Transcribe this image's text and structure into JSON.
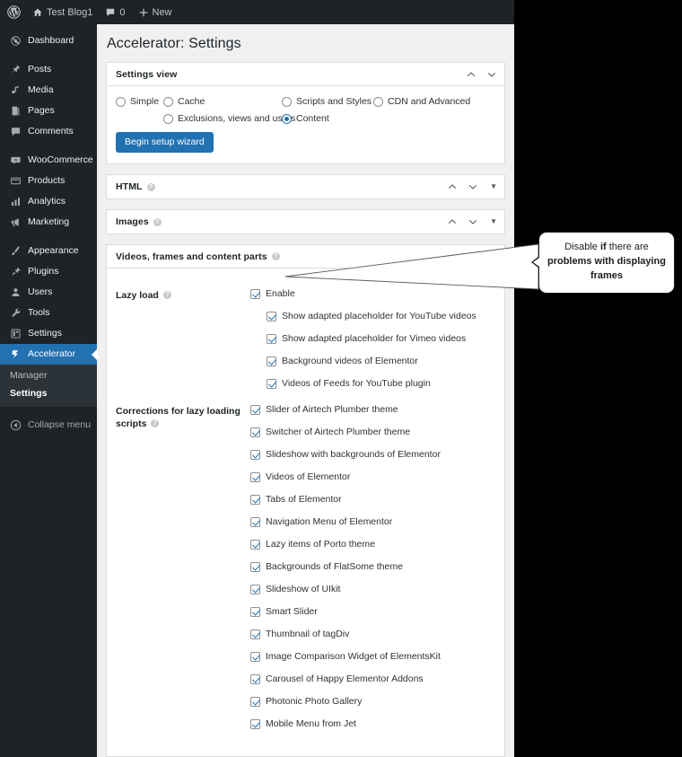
{
  "adminbar": {
    "items": [
      {
        "icon": "wordpress-logo-icon",
        "label": ""
      },
      {
        "icon": "home-icon",
        "label": "Test Blog1"
      },
      {
        "icon": "comment-icon",
        "label": "0"
      },
      {
        "icon": "plus-icon",
        "label": "New"
      }
    ]
  },
  "sidebar": {
    "items": [
      {
        "label": "Dashboard",
        "icon": "dashboard-icon"
      },
      {
        "label": "Posts",
        "icon": "pin-icon"
      },
      {
        "label": "Media",
        "icon": "media-icon"
      },
      {
        "label": "Pages",
        "icon": "page-icon"
      },
      {
        "label": "Comments",
        "icon": "comment-icon"
      },
      {
        "label": "WooCommerce",
        "icon": "woo-icon"
      },
      {
        "label": "Products",
        "icon": "products-icon"
      },
      {
        "label": "Analytics",
        "icon": "analytics-icon"
      },
      {
        "label": "Marketing",
        "icon": "megaphone-icon"
      },
      {
        "label": "Appearance",
        "icon": "brush-icon"
      },
      {
        "label": "Plugins",
        "icon": "plug-icon"
      },
      {
        "label": "Users",
        "icon": "users-icon"
      },
      {
        "label": "Tools",
        "icon": "wrench-icon"
      },
      {
        "label": "Settings",
        "icon": "settings-icon"
      },
      {
        "label": "Accelerator",
        "icon": "accelerator-icon"
      }
    ],
    "submenu": [
      {
        "label": "Manager",
        "current": false
      },
      {
        "label": "Settings",
        "current": true
      }
    ],
    "collapse": {
      "label": "Collapse menu",
      "icon": "collapse-icon"
    },
    "active_color": "#2271b1"
  },
  "page": {
    "title": "Accelerator: Settings"
  },
  "settings_view": {
    "title": "Settings view",
    "options": [
      {
        "label": "Simple",
        "selected": false
      },
      {
        "label": "Cache",
        "selected": false
      },
      {
        "label": "Scripts and Styles",
        "selected": false
      },
      {
        "label": "CDN and Advanced",
        "selected": false
      },
      {
        "label": "Exclusions, views and users",
        "selected": false
      },
      {
        "label": "Content",
        "selected": true
      }
    ],
    "wizard_button": "Begin setup wizard"
  },
  "panels": [
    {
      "title": "HTML",
      "expanded": false,
      "triangle": "▼"
    },
    {
      "title": "Images",
      "expanded": false,
      "triangle": "▼"
    },
    {
      "title": "Videos, frames and content parts",
      "expanded": true,
      "triangle": "▲"
    }
  ],
  "lazy_load": {
    "label": "Lazy load",
    "enable": {
      "label": "Enable",
      "checked": true
    },
    "sub_options": [
      {
        "label": "Show adapted placeholder for YouTube videos",
        "checked": true
      },
      {
        "label": "Show adapted placeholder for Vimeo videos",
        "checked": true
      },
      {
        "label": "Background videos of Elementor",
        "checked": true
      },
      {
        "label": "Videos of Feeds for YouTube plugin",
        "checked": true
      }
    ]
  },
  "corrections": {
    "label": "Corrections for lazy loading scripts",
    "items": [
      {
        "label": "Slider of Airtech Plumber theme",
        "checked": true
      },
      {
        "label": "Switcher of Airtech Plumber theme",
        "checked": true
      },
      {
        "label": "Slideshow with backgrounds of Elementor",
        "checked": true
      },
      {
        "label": "Videos of Elementor",
        "checked": true
      },
      {
        "label": "Tabs of Elementor",
        "checked": true
      },
      {
        "label": "Navigation Menu of Elementor",
        "checked": true
      },
      {
        "label": "Lazy items of Porto theme",
        "checked": true
      },
      {
        "label": "Backgrounds of FlatSome theme",
        "checked": true
      },
      {
        "label": "Slideshow of UIkit",
        "checked": true
      },
      {
        "label": "Smart Slider",
        "checked": true
      },
      {
        "label": "Thumbnail of tagDiv",
        "checked": true
      },
      {
        "label": "Image Comparison Widget of ElementsKit",
        "checked": true
      },
      {
        "label": "Carousel of Happy Elementor Addons",
        "checked": true
      },
      {
        "label": "Photonic Photo Gallery",
        "checked": true
      },
      {
        "label": "Mobile Menu from Jet",
        "checked": true
      }
    ]
  },
  "callout": {
    "part1": "Disable ",
    "part2": "if",
    "part3": " there are ",
    "part4": "problems with displaying frames"
  }
}
